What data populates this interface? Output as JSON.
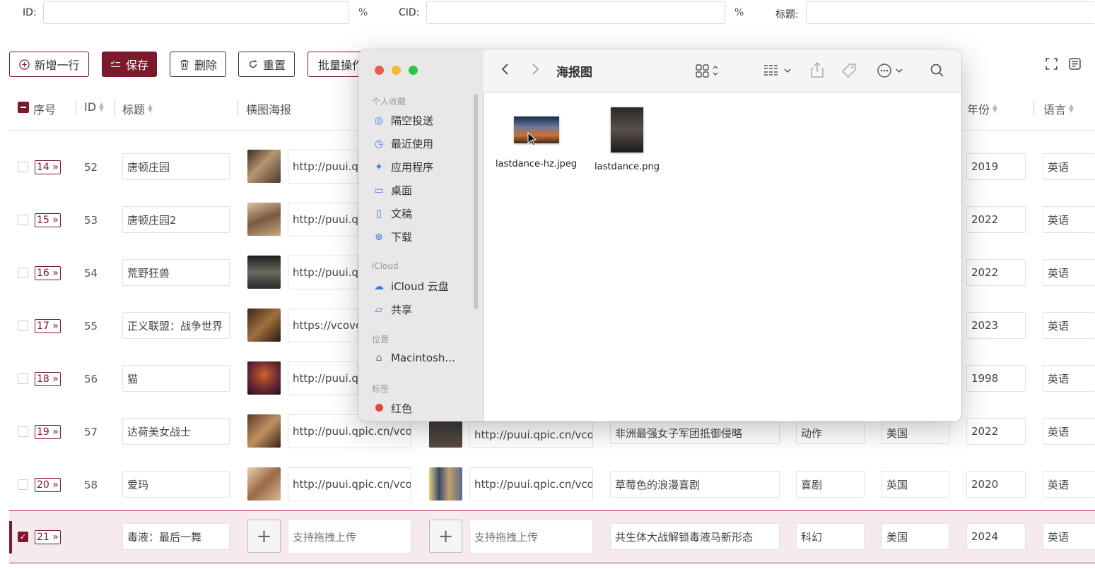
{
  "search": {
    "id_label": "ID:",
    "pct1": "%",
    "cid_label": "CID:",
    "pct2": "%",
    "title_label": "标题:"
  },
  "toolbar": {
    "add": "新增一行",
    "save": "保存",
    "delete": "删除",
    "reset": "重置",
    "batch": "批量操作"
  },
  "header": {
    "seq": "序号",
    "id": "ID",
    "title": "标题",
    "poster": "横图海报",
    "year": "年份",
    "lang": "语言"
  },
  "rows": [
    {
      "seq": "14",
      "id": "52",
      "title": "唐顿庄园",
      "poster": "http://puui.qp",
      "year": "2019",
      "lang": "英语"
    },
    {
      "seq": "15",
      "id": "53",
      "title": "唐顿庄园2",
      "poster": "http://puui.qp",
      "year": "2022",
      "lang": "英语"
    },
    {
      "seq": "16",
      "id": "54",
      "title": "荒野狂兽",
      "poster": "http://puui.qp",
      "year": "2022",
      "lang": "英语"
    },
    {
      "seq": "17",
      "id": "55",
      "title": "正义联盟：战争世界",
      "poster": "https://vcove",
      "year": "2023",
      "lang": "英语"
    },
    {
      "seq": "18",
      "id": "56",
      "title": "猫",
      "poster": "http://puui.qp",
      "year": "1998",
      "lang": "英语"
    },
    {
      "seq": "19",
      "id": "57",
      "title": "达荷美女战士",
      "poster": "http://puui.qpic.cn/vco",
      "poster2": "http://puui.qpic.cn/vco",
      "desc": "非洲最强女子军团抵御侵略",
      "genre": "动作",
      "country": "美国",
      "year": "2022",
      "lang": "英语"
    },
    {
      "seq": "20",
      "id": "58",
      "title": "爱玛",
      "poster": "http://puui.qpic.cn/vco",
      "poster2": "http://puui.qpic.cn/vco",
      "desc": "草莓色的浪漫喜剧",
      "genre": "喜剧",
      "country": "英国",
      "year": "2020",
      "lang": "英语"
    },
    {
      "seq": "21",
      "id": "",
      "title": "毒液：最后一舞",
      "poster": "支持拖拽上传",
      "poster2": "支持拖拽上传",
      "desc": "共生体大战解锁毒液马新形态",
      "genre": "科幻",
      "country": "美国",
      "year": "2024",
      "lang": "英语"
    }
  ],
  "finder": {
    "title": "海报图",
    "sec_fav": "个人收藏",
    "fav": [
      "隔空投送",
      "最近使用",
      "应用程序",
      "桌面",
      "文稿",
      "下载"
    ],
    "sec_icloud": "iCloud",
    "icloud": [
      "iCloud 云盘",
      "共享"
    ],
    "sec_loc": "位置",
    "loc": [
      "Macintosh..."
    ],
    "sec_tags": "标签",
    "tags": [
      "红色"
    ],
    "files": [
      "lastdance-hz.jpeg",
      "lastdance.png"
    ]
  },
  "colors": {
    "accent": "#7a1a2c",
    "tag_red": "#e8423a"
  }
}
